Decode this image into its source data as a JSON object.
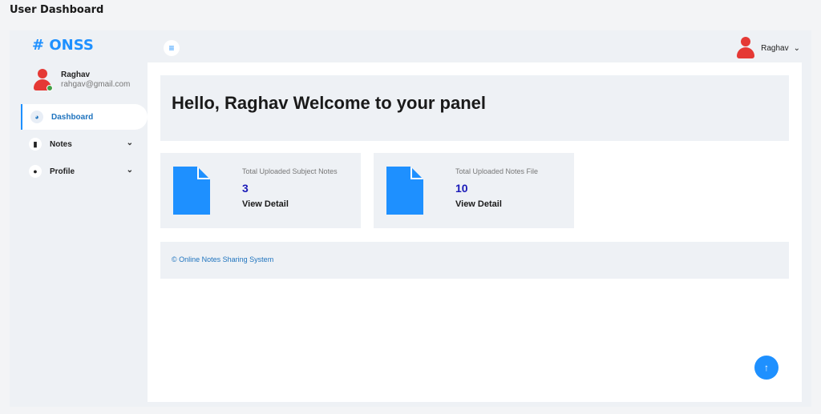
{
  "page": {
    "caption": "User Dashboard"
  },
  "sidebar": {
    "brand": "# ONSS",
    "user": {
      "name": "Raghav",
      "email": "rahgav@gmail.com"
    },
    "items": [
      {
        "label": "Dashboard",
        "icon": "dashboard-icon",
        "active": true
      },
      {
        "label": "Notes",
        "icon": "file-icon",
        "expandable": true
      },
      {
        "label": "Profile",
        "icon": "user-icon",
        "expandable": true
      }
    ]
  },
  "topbar": {
    "menu_icon": "hamburger-icon",
    "user_name": "Raghav"
  },
  "main": {
    "welcome": "Hello, Raghav Welcome to your panel",
    "cards": [
      {
        "label": "Total Uploaded Subject Notes",
        "value": "3",
        "link": "View Detail"
      },
      {
        "label": "Total Uploaded Notes File",
        "value": "10",
        "link": "View Detail"
      }
    ],
    "footer": "© Online Notes Sharing System"
  },
  "colors": {
    "accent": "#1e90ff",
    "avatar": "#e53935",
    "status_online": "#43a047"
  }
}
